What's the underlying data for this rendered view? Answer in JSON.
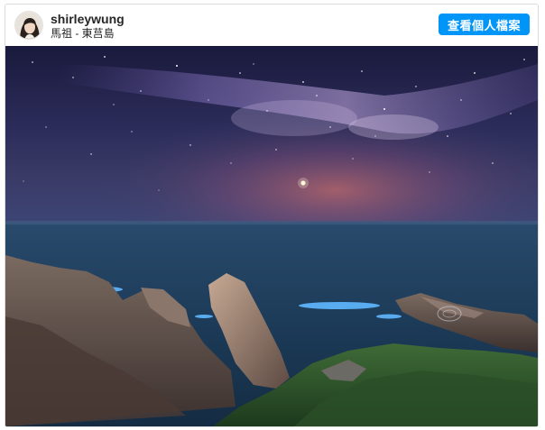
{
  "post": {
    "username": "shirleywung",
    "location": "馬祖 - 東莒島",
    "view_profile_label": "查看個人檔案"
  },
  "photo": {
    "description_icon": "starry-sea-photo"
  },
  "colors": {
    "button_bg": "#0095f6",
    "text": "#262626",
    "border": "#dbdbdb"
  }
}
